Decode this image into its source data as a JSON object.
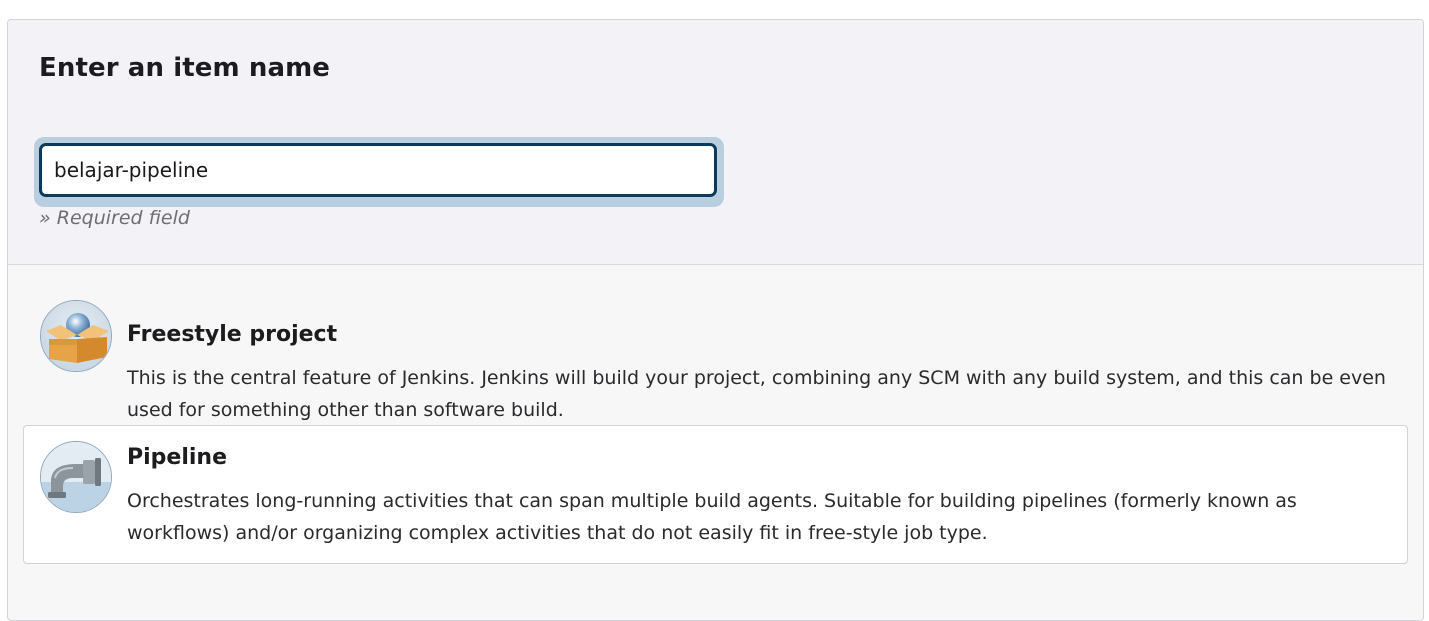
{
  "form": {
    "heading": "Enter an item name",
    "name_value": "belajar-pipeline",
    "required_note": "» Required field"
  },
  "item_types": [
    {
      "title": "Freestyle project",
      "description": "This is the central feature of Jenkins. Jenkins will build your project, combining any SCM with any build system, and this can be even used for something other than software build.",
      "icon": "freestyle-project-icon",
      "selected": false
    },
    {
      "title": "Pipeline",
      "description": "Orchestrates long-running activities that can span multiple build agents. Suitable for building pipelines (formerly known as workflows) and/or organizing complex activities that do not easily fit in free-style job type.",
      "icon": "pipeline-icon",
      "selected": true
    }
  ],
  "colors": {
    "input_border": "#0b3a5a",
    "input_focus_ring": "#b9cede",
    "header_background": "#f2f2f7"
  }
}
